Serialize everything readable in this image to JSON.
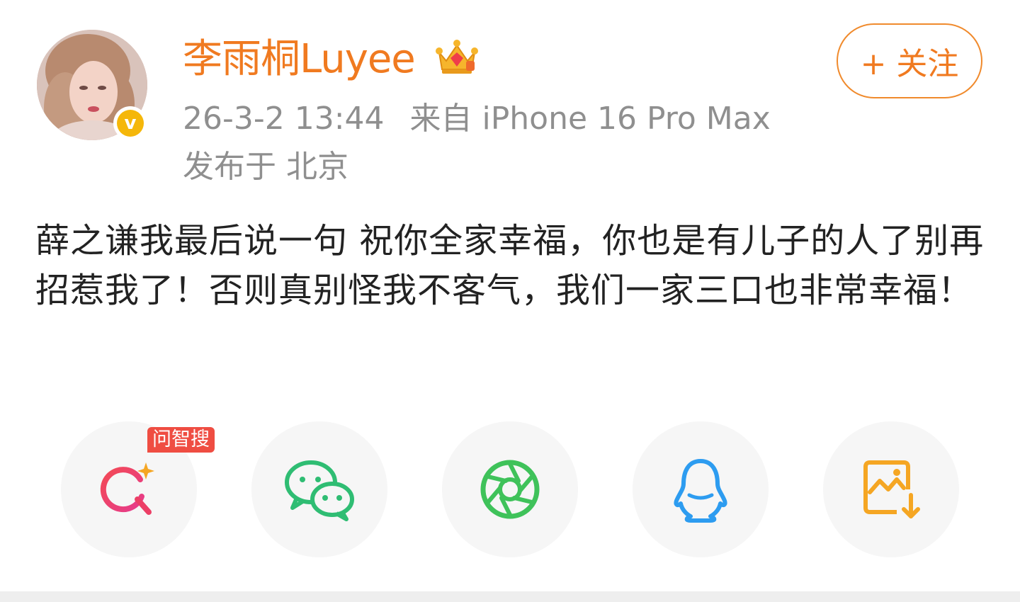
{
  "post": {
    "author": "李雨桐Luyee",
    "avatar_badge": "v",
    "follow_label": "+ 关注",
    "timestamp": "26-3-2 13:44",
    "source": "来自 iPhone 16 Pro Max",
    "location": "发布于 北京",
    "text": "薛之谦我最后说一句 祝你全家幸福，你也是有儿子的人了别再招惹我了！否则真别怪我不客气，我们一家三口也非常幸福！"
  },
  "share": {
    "items": [
      {
        "icon": "ai-search-icon",
        "tag": "问智搜"
      },
      {
        "icon": "wechat-icon"
      },
      {
        "icon": "moments-icon"
      },
      {
        "icon": "qq-icon"
      },
      {
        "icon": "save-image-icon"
      }
    ]
  },
  "colors": {
    "accent": "#f07a20",
    "meta_text": "#8f8f8f",
    "body_text": "#222222",
    "tag_red": "#ef4d42",
    "verified_gold": "#f5b70a",
    "share_bg": "#f6f6f6"
  }
}
